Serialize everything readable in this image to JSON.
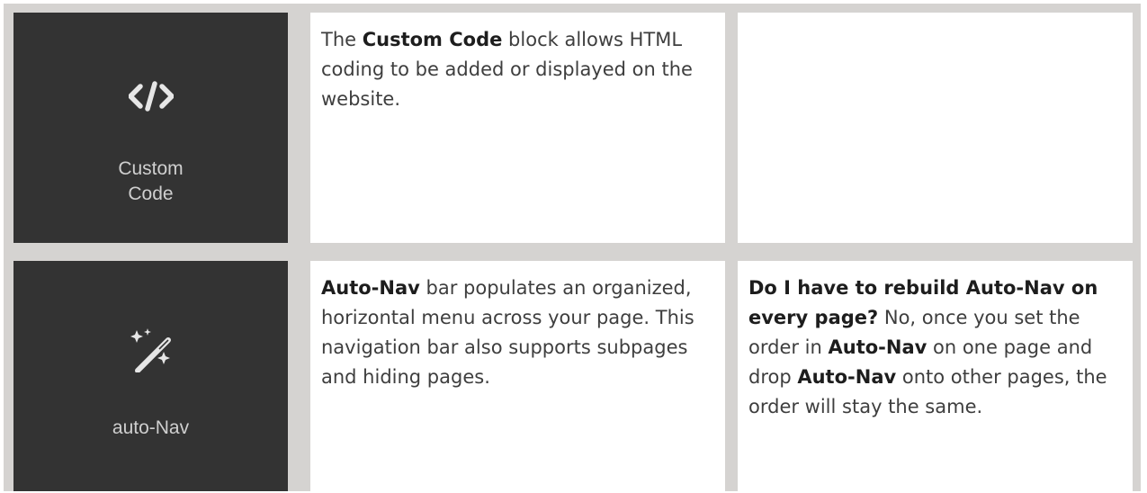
{
  "rows": [
    {
      "tile": {
        "icon": "code-brackets-icon",
        "label_line1": "Custom",
        "label_line2": "Code"
      },
      "description": {
        "pre": "The ",
        "strong": "Custom Code",
        "post": " block allows HTML coding to be added or displayed on the website."
      }
    },
    {
      "tile": {
        "icon": "magic-wand-icon",
        "label": "auto-Nav"
      },
      "description": {
        "strong": "Auto-Nav",
        "post": " bar populates an organized, horizontal menu across your page. This navigation bar also supports subpages and hiding pages."
      },
      "faq": {
        "question": "Do I have to rebuild Auto-Nav on every page?",
        "answer_1": " No, once you set the order in ",
        "strong_1": "Auto-Nav",
        "answer_2": " on one page and drop ",
        "strong_2": "Auto-Nav",
        "answer_3": " onto other pages, the order will stay the same."
      }
    }
  ],
  "colors": {
    "tile_background": "#333333",
    "grid_background": "#d5d3d1",
    "tile_text": "#cfcfcf"
  }
}
